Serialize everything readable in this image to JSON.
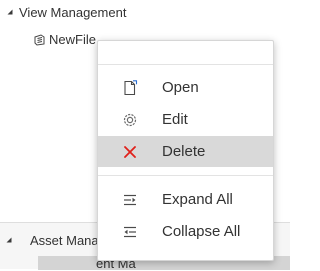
{
  "tree": {
    "view_management_label": "View Management",
    "newfile_label": "NewFile",
    "asset_management_label": "Asset Manag",
    "partial_row_label": "ent Ma"
  },
  "context_menu": {
    "items": [
      {
        "label": "Open",
        "icon": "open-file-icon"
      },
      {
        "label": "Edit",
        "icon": "gear-icon"
      },
      {
        "label": "Delete",
        "icon": "close-icon",
        "icon_color": "#e0211b",
        "selected": true
      },
      {
        "label": "Expand All",
        "icon": "expand-all-icon"
      },
      {
        "label": "Collapse All",
        "icon": "collapse-all-icon"
      }
    ]
  }
}
